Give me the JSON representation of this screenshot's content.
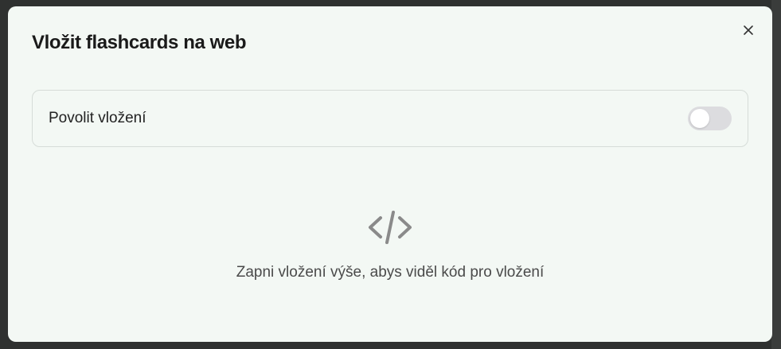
{
  "modal": {
    "title": "Vložit flashcards na web",
    "close_icon": "close-icon"
  },
  "embed_setting": {
    "label": "Povolit vložení",
    "enabled": false
  },
  "empty_state": {
    "icon": "code-icon",
    "message": "Zapni vložení výše, abys viděl kód pro vložení"
  },
  "colors": {
    "modal_background": "#f3f8f4",
    "toggle_off": "#dcdcdf",
    "icon": "#8a8a8a"
  }
}
